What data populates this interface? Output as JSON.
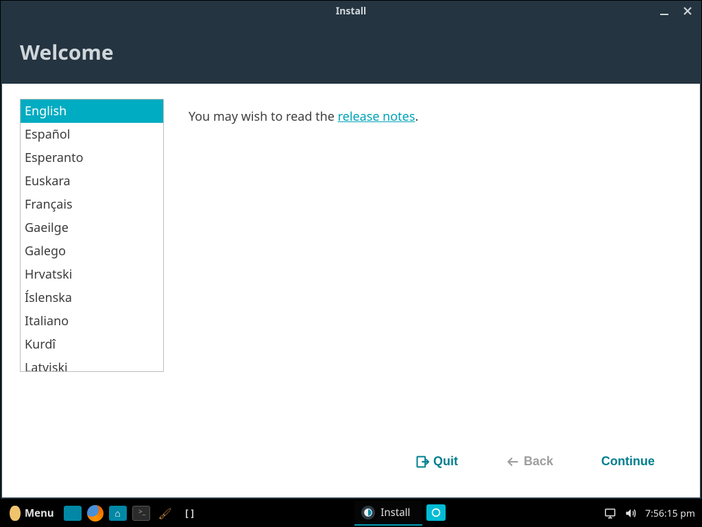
{
  "window": {
    "title": "Install",
    "heading": "Welcome"
  },
  "languages": [
    "English",
    "Español",
    "Esperanto",
    "Euskara",
    "Français",
    "Gaeilge",
    "Galego",
    "Hrvatski",
    "Íslenska",
    "Italiano",
    "Kurdî",
    "Latviski"
  ],
  "selected_language_index": 0,
  "info": {
    "prefix": "You may wish to read the ",
    "link_text": "release notes",
    "suffix": "."
  },
  "buttons": {
    "quit": "Quit",
    "back": "Back",
    "continue": "Continue"
  },
  "taskbar": {
    "menu": "Menu",
    "tasks": [
      {
        "label": "Install",
        "active": true
      }
    ],
    "clock": "7:56:15 pm"
  }
}
